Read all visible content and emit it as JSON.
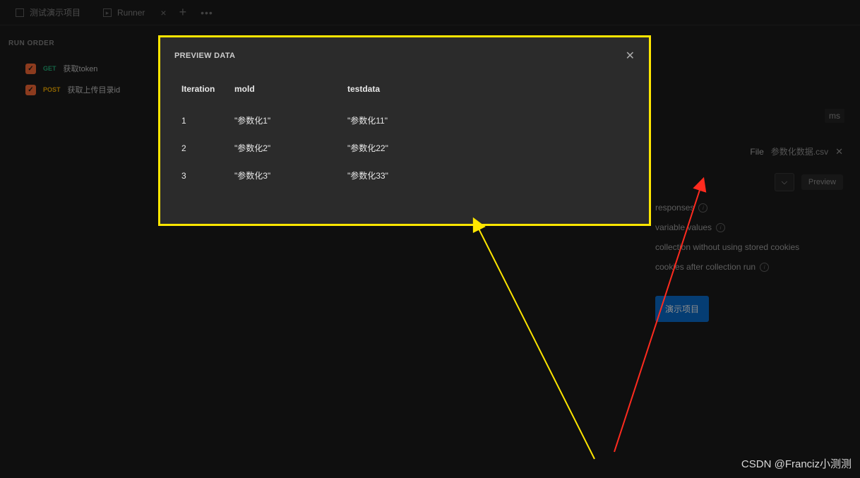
{
  "tabs": {
    "first": "测试演示项目",
    "second": "Runner"
  },
  "sidebar": {
    "title": "RUN ORDER",
    "items": [
      {
        "method": "GET",
        "name": "获取token"
      },
      {
        "method": "POST",
        "name": "获取上传目录id"
      }
    ]
  },
  "right": {
    "unit": "ms",
    "file_label": "File",
    "file_name": "参数化数据.csv",
    "preview_label": "Preview",
    "settings": [
      "responses",
      "variable values",
      "collection without using stored cookies",
      "cookies after collection run"
    ],
    "run_label": "演示项目"
  },
  "modal": {
    "title": "PREVIEW DATA",
    "headers": [
      "Iteration",
      "mold",
      "testdata"
    ],
    "rows": [
      {
        "iteration": "1",
        "mold": "\"参数化1\"",
        "testdata": "\"参数化11\""
      },
      {
        "iteration": "2",
        "mold": "\"参数化2\"",
        "testdata": "\"参数化22\""
      },
      {
        "iteration": "3",
        "mold": "\"参数化3\"",
        "testdata": "\"参数化33\""
      }
    ]
  },
  "watermark": "CSDN @Franciz小测测"
}
